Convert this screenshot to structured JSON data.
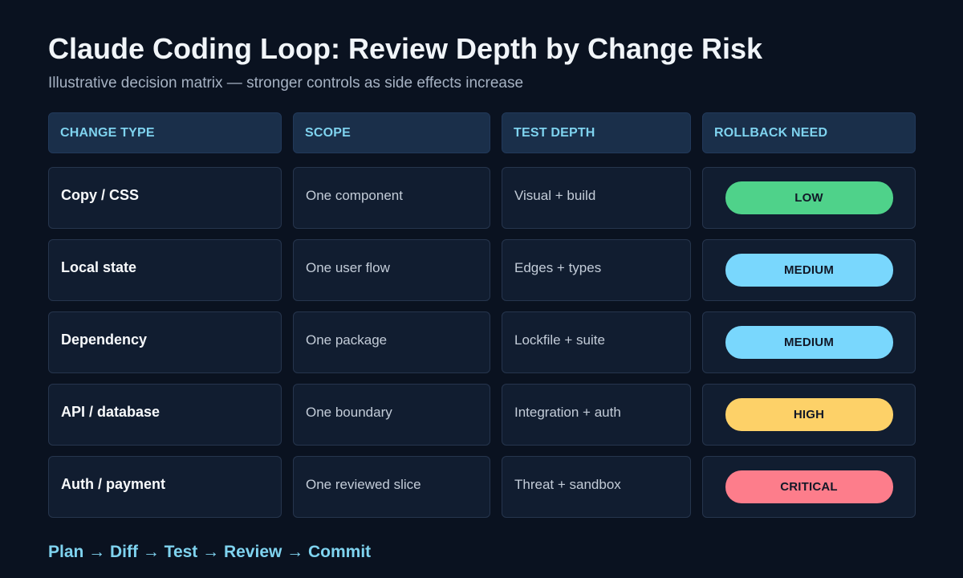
{
  "title": "Claude Coding Loop: Review Depth by Change Risk",
  "subtitle": "Illustrative decision matrix — stronger controls as side effects increase",
  "headers": {
    "change_type": "CHANGE TYPE",
    "scope": "SCOPE",
    "test_depth": "TEST DEPTH",
    "rollback_need": "ROLLBACK NEED"
  },
  "rows": [
    {
      "change_type": "Copy / CSS",
      "scope": "One component",
      "test_depth": "Visual + build",
      "rollback_need": "LOW",
      "badge_color": "#4fd28a"
    },
    {
      "change_type": "Local state",
      "scope": "One user flow",
      "test_depth": "Edges + types",
      "rollback_need": "MEDIUM",
      "badge_color": "#79d7fd"
    },
    {
      "change_type": "Dependency",
      "scope": "One package",
      "test_depth": "Lockfile + suite",
      "rollback_need": "MEDIUM",
      "badge_color": "#79d7fd"
    },
    {
      "change_type": "API / database",
      "scope": "One boundary",
      "test_depth": "Integration + auth",
      "rollback_need": "HIGH",
      "badge_color": "#fdd168"
    },
    {
      "change_type": "Auth / payment",
      "scope": "One reviewed slice",
      "test_depth": "Threat + sandbox",
      "rollback_need": "CRITICAL",
      "badge_color": "#fd7d8b"
    }
  ],
  "footer": "Plan → Diff → Test → Review → Commit",
  "colors": {
    "background": "#0a1220",
    "header_bg": "#1a2f4a",
    "cell_bg": "#111d30",
    "accent": "#7fd3ef"
  }
}
